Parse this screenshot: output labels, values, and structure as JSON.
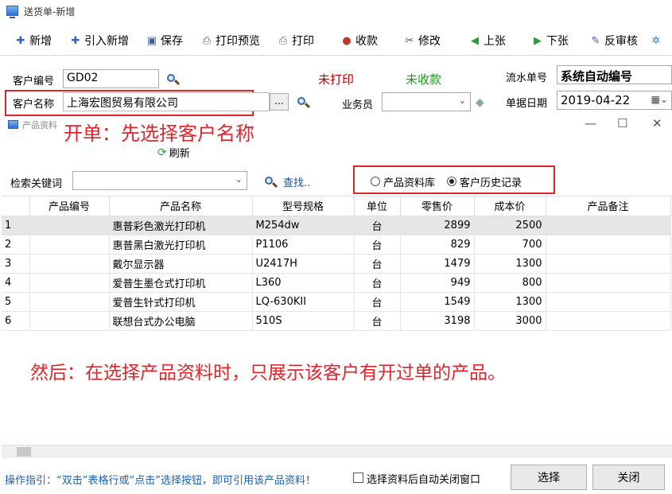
{
  "window": {
    "title": "送货单-新增"
  },
  "toolbar": {
    "items": [
      {
        "label": "新增"
      },
      {
        "label": "引入新增"
      },
      {
        "label": "保存"
      },
      {
        "label": "打印预览"
      },
      {
        "label": "打印"
      },
      {
        "label": "收款"
      },
      {
        "label": "修改"
      },
      {
        "label": "上张"
      },
      {
        "label": "下张"
      },
      {
        "label": "反审核"
      }
    ]
  },
  "form": {
    "customer_code_label": "客户编号",
    "customer_code_value": "GD02",
    "customer_name_label": "客户名称",
    "customer_name_value": "上海宏图贸易有限公司",
    "ellipsis": "...",
    "print_status": "未打印",
    "payment_status": "未收款",
    "serial_label": "流水单号",
    "serial_value": "系统自动编号",
    "salesman_label": "业务员",
    "salesman_value": "",
    "date_label": "单据日期",
    "date_value": "2019-04-22"
  },
  "product_window": {
    "title": "产品资料",
    "refresh": "刷新",
    "search_label": "检索关键词",
    "search_value": "",
    "find": "查找..",
    "radio_library": "产品资料库",
    "radio_history": "客户历史记录"
  },
  "annotations": {
    "top": "开单：先选择客户名称",
    "bottom": "然后：在选择产品资料时，只展示该客户有开过单的产品。"
  },
  "table": {
    "columns": [
      "产品编号",
      "产品名称",
      "型号规格",
      "单位",
      "零售价",
      "成本价",
      "产品备注"
    ],
    "rows": [
      {
        "no": "1",
        "code": "",
        "name": "惠普彩色激光打印机",
        "model": "M254dw",
        "unit": "台",
        "retail": "2899",
        "cost": "2500",
        "note": ""
      },
      {
        "no": "2",
        "code": "",
        "name": "惠普黑白激光打印机",
        "model": "P1106",
        "unit": "台",
        "retail": "829",
        "cost": "700",
        "note": ""
      },
      {
        "no": "3",
        "code": "",
        "name": "戴尔显示器",
        "model": "U2417H",
        "unit": "台",
        "retail": "1479",
        "cost": "1300",
        "note": ""
      },
      {
        "no": "4",
        "code": "",
        "name": "爱普生墨仓式打印机",
        "model": "L360",
        "unit": "台",
        "retail": "949",
        "cost": "800",
        "note": ""
      },
      {
        "no": "5",
        "code": "",
        "name": "爱普生针式打印机",
        "model": "LQ-630KII",
        "unit": "台",
        "retail": "1549",
        "cost": "1300",
        "note": ""
      },
      {
        "no": "6",
        "code": "",
        "name": "联想台式办公电脑",
        "model": "510S",
        "unit": "台",
        "retail": "3198",
        "cost": "3000",
        "note": ""
      }
    ]
  },
  "footer": {
    "hint": "操作指引：“双击”表格行或“点击”选择按钮，即可引用该产品资料！",
    "auto_close": "选择资料后自动关闭窗口",
    "select_button": "选择",
    "close_button": "关闭"
  },
  "colors": {
    "annotation": "#e0242a",
    "print_status": "#c00000",
    "payment_status": "#1a9a1a",
    "hint": "#1a5fb4"
  }
}
